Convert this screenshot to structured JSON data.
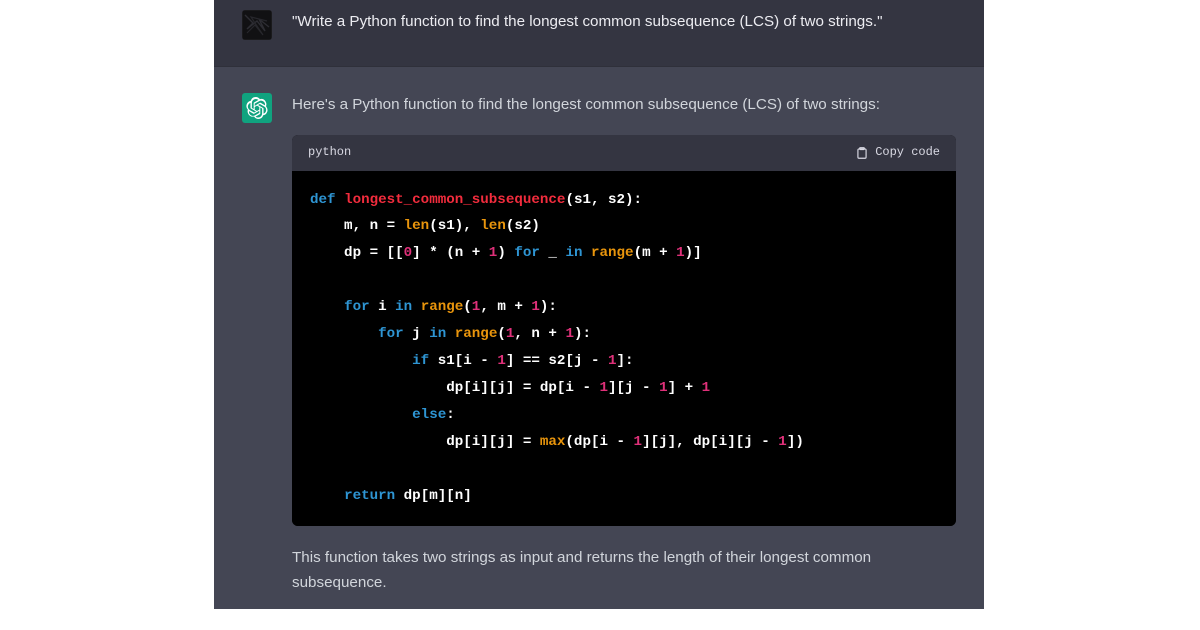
{
  "user": {
    "text": "\"Write a Python function to find the longest common subsequence (LCS) of two strings.\""
  },
  "assistant": {
    "intro": "Here's a Python function to find the longest common subsequence (LCS) of two strings:",
    "code": {
      "language": "python",
      "copy_label": "Copy code",
      "tokens": {
        "def": "def",
        "fn_name": "longest_common_subsequence",
        "sig_tail": "(s1, s2):",
        "l2a": "    m, n = ",
        "len1": "len",
        "l2b": "(s1), ",
        "len2": "len",
        "l2c": "(s2)",
        "l3a": "    dp = [[",
        "zero": "0",
        "l3b": "] * (n + ",
        "one1": "1",
        "l3c": ") ",
        "for1": "for",
        "l3d": " _ ",
        "in1": "in",
        "l3e": " ",
        "range1": "range",
        "l3f": "(m + ",
        "one2": "1",
        "l3g": ")]",
        "l5a": "    ",
        "for2": "for",
        "l5b": " i ",
        "in2": "in",
        "l5c": " ",
        "range2": "range",
        "l5d": "(",
        "one3": "1",
        "l5e": ", m + ",
        "one4": "1",
        "l5f": "):",
        "l6a": "        ",
        "for3": "for",
        "l6b": " j ",
        "in3": "in",
        "l6c": " ",
        "range3": "range",
        "l6d": "(",
        "one5": "1",
        "l6e": ", n + ",
        "one6": "1",
        "l6f": "):",
        "l7a": "            ",
        "if1": "if",
        "l7b": " s1[i - ",
        "one7": "1",
        "l7c": "] == s2[j - ",
        "one8": "1",
        "l7d": "]:",
        "l8a": "                dp[i][j] = dp[i - ",
        "one9": "1",
        "l8b": "][j - ",
        "one10": "1",
        "l8c": "] + ",
        "one11": "1",
        "l9a": "            ",
        "else1": "else",
        "l9b": ":",
        "l10a": "                dp[i][j] = ",
        "max1": "max",
        "l10b": "(dp[i - ",
        "one12": "1",
        "l10c": "][j], dp[i][j - ",
        "one13": "1",
        "l10d": "])",
        "l12a": "    ",
        "return1": "return",
        "l12b": " dp[m][n]"
      }
    },
    "outro": "This function takes two strings as input and returns the length of their longest common subsequence."
  }
}
